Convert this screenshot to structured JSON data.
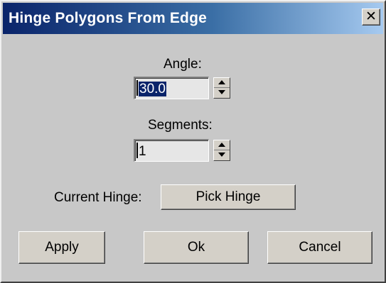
{
  "window": {
    "title": "Hinge Polygons From Edge",
    "close_glyph": "✕"
  },
  "angle": {
    "label": "Angle:",
    "value": "30.0"
  },
  "segments": {
    "label": "Segments:",
    "value": "1"
  },
  "hinge": {
    "label": "Current Hinge:",
    "button_label": "Pick Hinge"
  },
  "footer": {
    "apply_label": "Apply",
    "ok_label": "Ok",
    "cancel_label": "Cancel"
  },
  "colors": {
    "title_gradient_start": "#0a246a",
    "title_gradient_end": "#a6caf0",
    "dialog_face": "#c8c8c8",
    "selection_highlight": "#0a246a"
  },
  "icons": {
    "close": "close-icon",
    "spinner_up": "chevron-up-icon",
    "spinner_down": "chevron-down-icon"
  }
}
